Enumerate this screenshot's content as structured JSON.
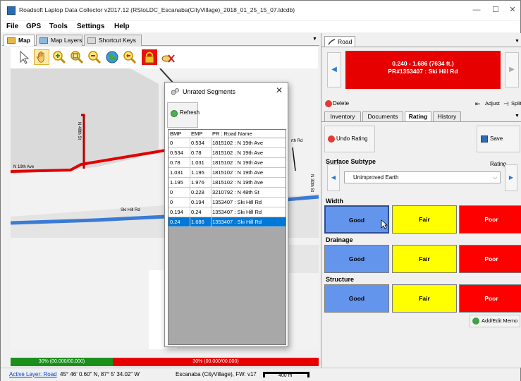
{
  "window": {
    "title": "Roadsoft Laptop Data Collector v2017.12 (RStoLDC_Escanaba(CityVillage)_2018_01_25_15_07.ldcdb)",
    "controls": [
      "—",
      "☐",
      "✕"
    ]
  },
  "menu": [
    "File",
    "GPS",
    "Tools",
    "Settings",
    "Help"
  ],
  "left_tabs": [
    "Map",
    "Map Layers",
    "Shortcut Keys"
  ],
  "toolbar_icons": [
    "pointer-icon",
    "pan-hand-icon",
    "zoom-in-icon",
    "zoom-window-icon",
    "zoom-out-icon",
    "zoom-extent-icon",
    "zoom-previous-icon",
    "lock-icon",
    "clear-selection-icon"
  ],
  "map": {
    "street_labels": [
      "N 19th Ave",
      "N 48th St",
      "Ski Hill Rd",
      "N 30th St",
      "rth Rd"
    ]
  },
  "coverage": {
    "green_text": "30% (00.000/00.000)",
    "red_text": "30% (00.000/00.000)"
  },
  "status": {
    "active_layer": "Active Layer: Road",
    "coords": "45° 46' 0.60\" N, 87° 5' 34.02\" W",
    "region": "Escanaba (CityVillage), FW: v17",
    "scale": "400 m"
  },
  "dialog": {
    "title": "Unrated Segments",
    "refresh_label": "Refresh",
    "columns": [
      "BMP",
      "EMP",
      "PR : Road Name"
    ],
    "rows": [
      {
        "bmp": "0",
        "emp": "0.534",
        "name": "1815102 : N 19th Ave"
      },
      {
        "bmp": "0.534",
        "emp": "0.78",
        "name": "1815102 : N 19th Ave"
      },
      {
        "bmp": "0.78",
        "emp": "1.031",
        "name": "1815102 : N 19th Ave"
      },
      {
        "bmp": "1.031",
        "emp": "1.195",
        "name": "1815102 : N 19th Ave"
      },
      {
        "bmp": "1.195",
        "emp": "1.976",
        "name": "1815102 : N 19th Ave"
      },
      {
        "bmp": "0",
        "emp": "0.228",
        "name": "3210792 : N 48th St"
      },
      {
        "bmp": "0",
        "emp": "0.194",
        "name": "1353407 : Ski Hill Rd"
      },
      {
        "bmp": "0.194",
        "emp": "0.24",
        "name": "1353407 : Ski Hill Rd"
      },
      {
        "bmp": "0.24",
        "emp": "1.686",
        "name": "1353407 : Ski Hill Rd"
      }
    ],
    "selected_row": 8
  },
  "right": {
    "tab": "Road",
    "segment_line1": "0.240 - 1.686 (7634 ft.)",
    "segment_line2": "PR#1353407 : Ski Hill Rd",
    "segment_color": "#e60000",
    "delete_label": "Delete",
    "adjust_label": "Adjust",
    "split_label": "Split",
    "subtabs": [
      "Inventory",
      "Documents",
      "Rating",
      "History"
    ],
    "active_subtab": "Rating",
    "undo_label": "Undo Rating",
    "save_label": "Save Rating",
    "surface_title": "Surface Subtype",
    "surface_value": "Unimproved Earth",
    "sections": [
      {
        "title": "Width",
        "good": "Good",
        "fair": "Fair",
        "poor": "Poor"
      },
      {
        "title": "Drainage",
        "good": "Good",
        "fair": "Fair",
        "poor": "Poor"
      },
      {
        "title": "Structure",
        "good": "Good",
        "fair": "Fair",
        "poor": "Poor"
      }
    ],
    "memo_label": "Add/Edit Memo"
  },
  "colors": {
    "good": "#6495ed",
    "fair": "#ffff00",
    "poor": "#ff0000",
    "selected_row": "#0078d7",
    "coverage_green": "#1a8f1a",
    "coverage_red": "#e60000"
  }
}
